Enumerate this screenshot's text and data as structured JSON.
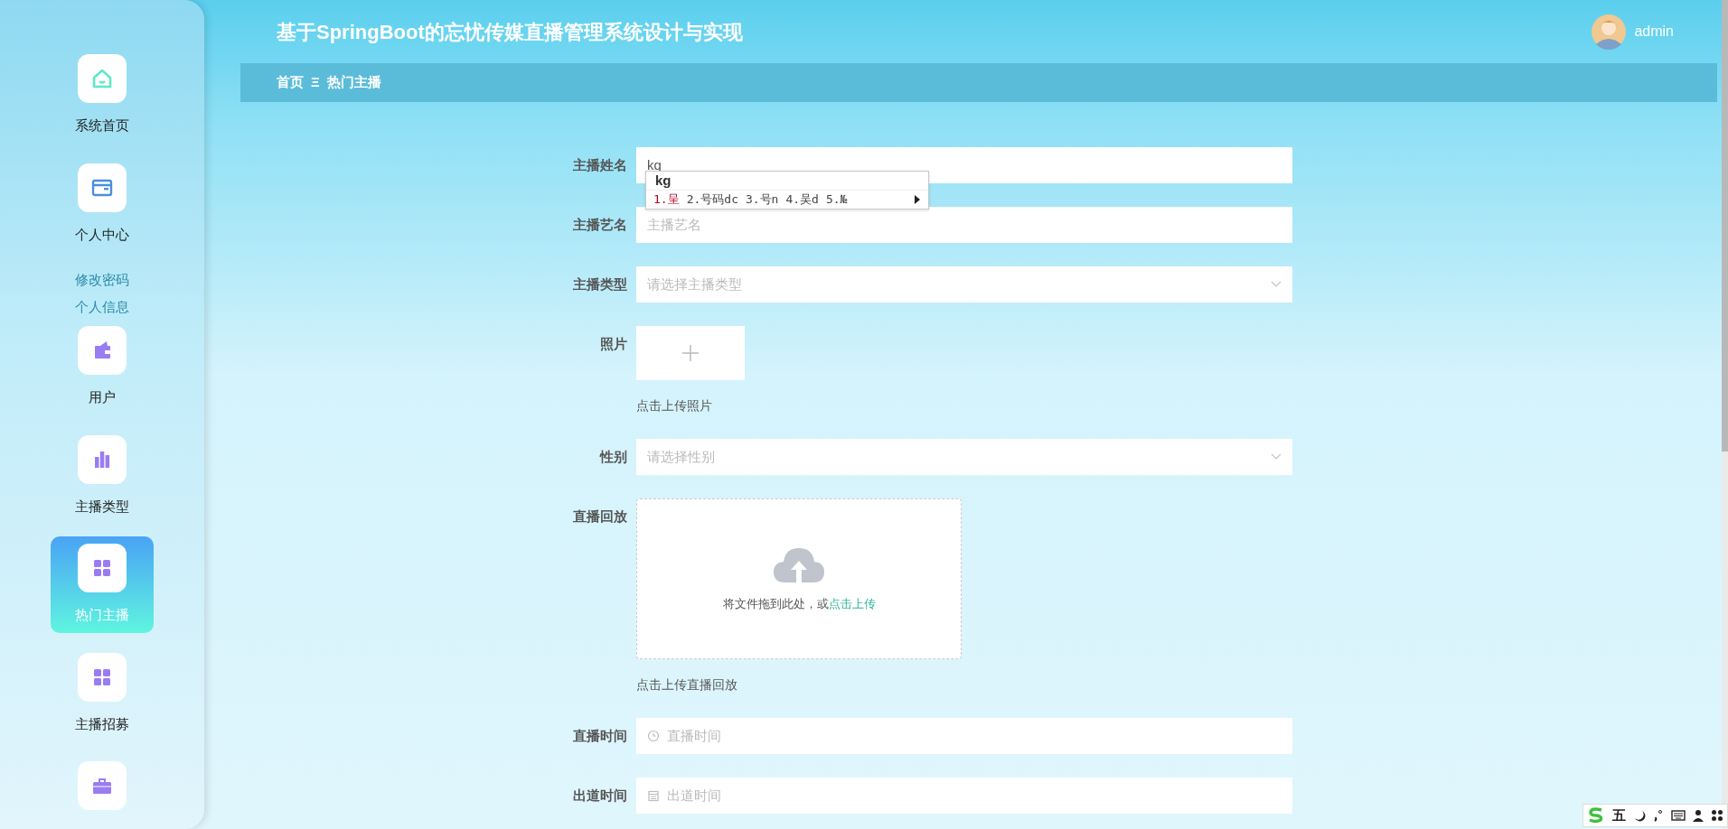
{
  "header": {
    "title": "基于SpringBoot的忘忧传媒直播管理系统设计与实现",
    "user": "admin"
  },
  "breadcrumb": {
    "items": [
      "首页",
      "热门主播"
    ],
    "separator": "Ξ"
  },
  "sidebar": {
    "items": [
      {
        "label": "系统首页",
        "selected": false
      },
      {
        "label": "个人中心",
        "selected": false,
        "children": [
          {
            "label": "修改密码"
          },
          {
            "label": "个人信息"
          }
        ]
      },
      {
        "label": "用户",
        "selected": false
      },
      {
        "label": "主播类型",
        "selected": false
      },
      {
        "label": "热门主播",
        "selected": true
      },
      {
        "label": "主播招募",
        "selected": false
      },
      {
        "selected": false
      }
    ]
  },
  "form": {
    "fields": [
      {
        "kind": "text",
        "label": "主播姓名",
        "value": "kg"
      },
      {
        "kind": "text",
        "label": "主播艺名",
        "placeholder": "主播艺名"
      },
      {
        "kind": "select",
        "label": "主播类型",
        "placeholder": "请选择主播类型"
      },
      {
        "kind": "image",
        "label": "照片",
        "hint": "点击上传照片"
      },
      {
        "kind": "select",
        "label": "性别",
        "placeholder": "请选择性别"
      },
      {
        "kind": "dragger",
        "label": "直播回放",
        "text": "将文件拖到此处，或",
        "link": "点击上传",
        "hint": "点击上传直播回放"
      },
      {
        "kind": "datetime",
        "label": "直播时间",
        "placeholder": "直播时间"
      },
      {
        "kind": "date",
        "label": "出道时间",
        "placeholder": "出道时间"
      }
    ]
  },
  "ime": {
    "composition": "kg",
    "candidates": [
      {
        "text": "1.呈",
        "selected": true
      },
      {
        "text": "2.号码dc",
        "selected": false
      },
      {
        "text": "3.号n",
        "selected": false
      },
      {
        "text": "4.吴d",
        "selected": false
      },
      {
        "text": "5.№",
        "selected": false
      }
    ],
    "toolbar": {
      "mode": "五"
    }
  }
}
